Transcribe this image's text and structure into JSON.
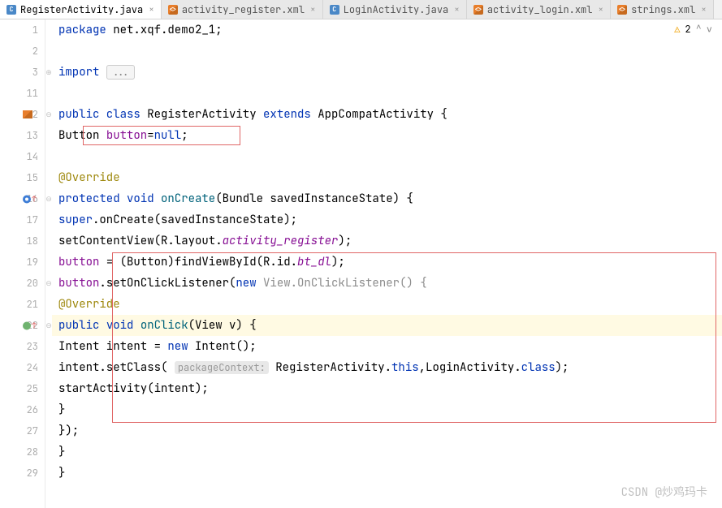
{
  "tabs": [
    {
      "icon": "java",
      "label": "RegisterActivity.java",
      "active": true
    },
    {
      "icon": "xml",
      "label": "activity_register.xml",
      "active": false
    },
    {
      "icon": "java",
      "label": "LoginActivity.java",
      "active": false
    },
    {
      "icon": "xml",
      "label": "activity_login.xml",
      "active": false
    },
    {
      "icon": "xml",
      "label": "strings.xml",
      "active": false
    }
  ],
  "tabs_more": "⋮",
  "warn": {
    "count": "2",
    "up": "^",
    "down": "∨",
    "tri": "⚠"
  },
  "gutter": [
    "1",
    "2",
    "3",
    "11",
    "12",
    "13",
    "14",
    "15",
    "16",
    "17",
    "18",
    "19",
    "20",
    "21",
    "22",
    "23",
    "24",
    "25",
    "26",
    "27",
    "28",
    "29"
  ],
  "code": {
    "l1": {
      "kw": "package",
      "rest": " net.xqf.demo2_1;"
    },
    "l3": {
      "kw": "import",
      "box": "..."
    },
    "l12": {
      "kw1": "public class",
      "cls": " RegisterActivity ",
      "kw2": "extends",
      "sup": " AppCompatActivity {"
    },
    "l13": {
      "type": "Button ",
      "field": "button",
      "eq": "=",
      "kw": "null",
      "semi": ";"
    },
    "l15": {
      "anno": "@Override"
    },
    "l16": {
      "kw1": "protected ",
      "kw2": "void ",
      "mth": "onCreate",
      "open": "(Bundle savedInstanceState) {"
    },
    "l17": {
      "kw": "super",
      "rest": ".onCreate(savedInstanceState);"
    },
    "l18": {
      "a": "setContentView(R.layout.",
      "field": "activity_register",
      "b": ");"
    },
    "l19": {
      "field": "button",
      "a": " = (Button)findViewById(R.id.",
      "field2": "bt_dl",
      "b": ");"
    },
    "l20": {
      "field": "button",
      "a": ".setOnClickListener(",
      "kw": "new ",
      "grey": "View.OnClickListener() {"
    },
    "l21": {
      "anno": "@Override"
    },
    "l22": {
      "kw1": "public ",
      "kw2": "void ",
      "mth": "onClick",
      "rest": "(View v) {"
    },
    "l23": {
      "a": "Intent intent = ",
      "kw": "new ",
      "b": "Intent();"
    },
    "l24": {
      "a": "intent.setClass( ",
      "hint": "packageContext:",
      "b": " RegisterActivity.",
      "kw": "this",
      "c": ",LoginActivity.",
      "kw2": "class",
      "d": ");"
    },
    "l25": {
      "a": "startActivity(intent);"
    },
    "l26": {
      "a": "}"
    },
    "l27": {
      "a": "});"
    },
    "l28": {
      "a": "}"
    },
    "l29": {
      "a": "}"
    }
  },
  "watermark": "CSDN @炒鸡玛卡"
}
